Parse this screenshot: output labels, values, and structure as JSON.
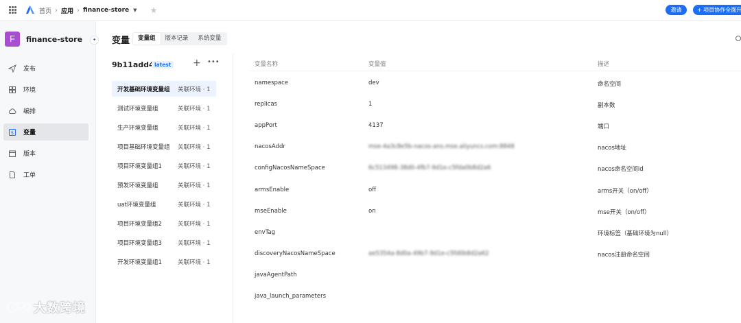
{
  "topbar": {
    "breadcrumb": [
      "首页",
      "应用",
      "finance-store"
    ],
    "invite_label": "邀请",
    "collab_label": "+ 项目协作全面升"
  },
  "sidebar": {
    "app_initial": "F",
    "app_name": "finance-store",
    "items": [
      {
        "label": "发布",
        "icon": "send-icon",
        "active": false
      },
      {
        "label": "环境",
        "icon": "grid-icon",
        "active": false
      },
      {
        "label": "编排",
        "icon": "cloud-icon",
        "active": false
      },
      {
        "label": "变量",
        "icon": "variable-icon",
        "active": true
      },
      {
        "label": "版本",
        "icon": "calendar-icon",
        "active": false
      },
      {
        "label": "工单",
        "icon": "document-icon",
        "active": false
      }
    ]
  },
  "main": {
    "title": "变量",
    "tabs": [
      {
        "label": "变量组",
        "active": true
      },
      {
        "label": "版本记录",
        "active": false
      },
      {
        "label": "系统变量",
        "active": false
      }
    ]
  },
  "groups": {
    "version": "9b11add4",
    "tag": "latest",
    "items": [
      {
        "name": "开发基础环境变量组",
        "env": "关联环境 · 1",
        "active": true
      },
      {
        "name": "测试环境变量组",
        "env": "关联环境 · 1",
        "active": false
      },
      {
        "name": "生产环境变量组",
        "env": "关联环境 · 1",
        "active": false
      },
      {
        "name": "项目基础环境变量组",
        "env": "关联环境 · 1",
        "active": false
      },
      {
        "name": "项目环境变量组1",
        "env": "关联环境 · 1",
        "active": false
      },
      {
        "name": "预发环境变量组",
        "env": "关联环境 · 1",
        "active": false
      },
      {
        "name": "uat环境变量组",
        "env": "关联环境 · 1",
        "active": false
      },
      {
        "name": "项目环境变量组2",
        "env": "关联环境 · 1",
        "active": false
      },
      {
        "name": "项目环境变量组3",
        "env": "关联环境 · 1",
        "active": false
      },
      {
        "name": "开发环境变量组1",
        "env": "关联环境 · 1",
        "active": false
      }
    ]
  },
  "table": {
    "headers": [
      "变量名称",
      "变量值",
      "描述"
    ],
    "rows": [
      {
        "name": "namespace",
        "value": "dev",
        "desc": "命名空间",
        "masked": false
      },
      {
        "name": "replicas",
        "value": "1",
        "desc": "副本数",
        "masked": false
      },
      {
        "name": "appPort",
        "value": "4137",
        "desc": "端口",
        "masked": false
      },
      {
        "name": "nacosAddr",
        "value": "mse-4a3c8e5b-nacos-ans.mse.aliyuncs.com:8848",
        "desc": "nacos地址",
        "masked": true
      },
      {
        "name": "configNacosNameSpace",
        "value": "6c513498-38d0-4fb7-9d1e-c5fda0b8d2a6",
        "desc": "nacos命名空间id",
        "masked": true
      },
      {
        "name": "armsEnable",
        "value": "off",
        "desc": "arms开关（on/off）",
        "masked": false
      },
      {
        "name": "mseEnable",
        "value": "on",
        "desc": "mse开关（on/off）",
        "masked": false
      },
      {
        "name": "envTag",
        "value": "",
        "desc": "环境标签（基础环境为null）",
        "masked": false
      },
      {
        "name": "discoveryNacosNameSpace",
        "value": "ae5354a-8d0a-49b7-9d1e-c5fd0b8d2a62",
        "desc": "nacos注册命名空间",
        "masked": true
      },
      {
        "name": "javaAgentPath",
        "value": "",
        "desc": "",
        "masked": false
      },
      {
        "name": "java_launch_parameters",
        "value": "",
        "desc": "",
        "masked": false
      }
    ]
  },
  "watermark": {
    "text": "大数跨境"
  },
  "colors": {
    "accent": "#1b6ef3",
    "avatar": "#a84fd1",
    "active_row": "#edf3fe"
  }
}
